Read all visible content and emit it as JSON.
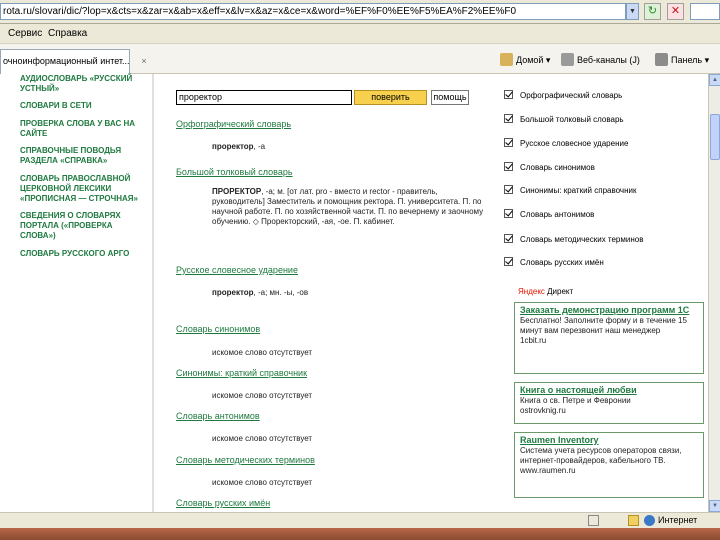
{
  "browser": {
    "address": "rota.ru/slovari/dic/?lop=x&cts=x&zar=x&ab=x&eff=x&lv=x&az=x&ce=x&word=%EF%F0%EE%F5%EA%F2%EE%F0",
    "menu": [
      "Сервис",
      "Справка"
    ],
    "tab_title": "очноинформационный интет...",
    "tab_close": "×",
    "cmd_home": "Домой",
    "cmd_feeds": "Веб-каналы (J)",
    "cmd_page": "Панель",
    "status_zone": "Интернет"
  },
  "nav": [
    "Аудиословарь «Русский устный»",
    "Словари в сети",
    "Проверка слова у вас на сайте",
    "Справочные поводья раздела «Справка»",
    "Словарь православной церковной лексики «Прописная — строчная»",
    "Сведения о словарях портала («Проверка слова»)",
    "Словарь русского арго"
  ],
  "search": {
    "query": "проректор",
    "button": "поверить",
    "help": "помощь"
  },
  "dictionaries": [
    {
      "title": "Орфографический словарь",
      "body_head": "проректор",
      "body": ", -а"
    },
    {
      "title": "Большой толковый словарь",
      "body_head": "ПРОРЕКТОР",
      "body": ", -а; м. [от лат. pro - вместо и rector - правитель, руководитель] Заместитель и помощник ректора. П. университета. П. по научной работе. П. по хозяйственной части. П. по вечернему и заочному обучению. ◇ Проректорский, -ая, -ое. П. кабинет."
    },
    {
      "title": "Русское словесное ударение",
      "body_head": "проректор",
      "body": ", -а; мн. -ы, -ов"
    },
    {
      "title": "Словарь синонимов",
      "missing": "искомое слово отсутствует"
    },
    {
      "title": "Синонимы: краткий справочник",
      "missing": "искомое слово отсутствует"
    },
    {
      "title": "Словарь антонимов",
      "missing": "искомое слово отсутствует"
    },
    {
      "title": "Словарь методических терминов",
      "missing": "искомое слово отсутствует"
    },
    {
      "title": "Словарь русских имён",
      "missing": ""
    }
  ],
  "filters": [
    "Орфографический словарь",
    "Большой толковый словарь",
    "Русское словесное ударение",
    "Словарь синонимов",
    "Синонимы: краткий справочник",
    "Словарь антонимов",
    "Словарь методических терминов",
    "Словарь русских имён"
  ],
  "direct": {
    "yandex": "Яндекс",
    "label": "Директ"
  },
  "ads": [
    {
      "title": "Заказать демонстрацию программ 1С",
      "text": "Бесплатно! Заполните форму и в течение 15 минут вам перезвонит наш менеджер",
      "url": "1cbit.ru"
    },
    {
      "title": "Книга о настоящей любви",
      "text": "Книга о св. Петре и Февронии",
      "url": "ostrovknig.ru"
    },
    {
      "title": "Raumen Inventory",
      "text": "Система учета ресурсов операторов связи, интернет-провайдеров, кабельного ТВ.",
      "url": "www.raumen.ru"
    }
  ],
  "colors": {
    "link": "#1f7a40",
    "search_button": "#f7d04e",
    "chrome": "#ece9d8"
  }
}
